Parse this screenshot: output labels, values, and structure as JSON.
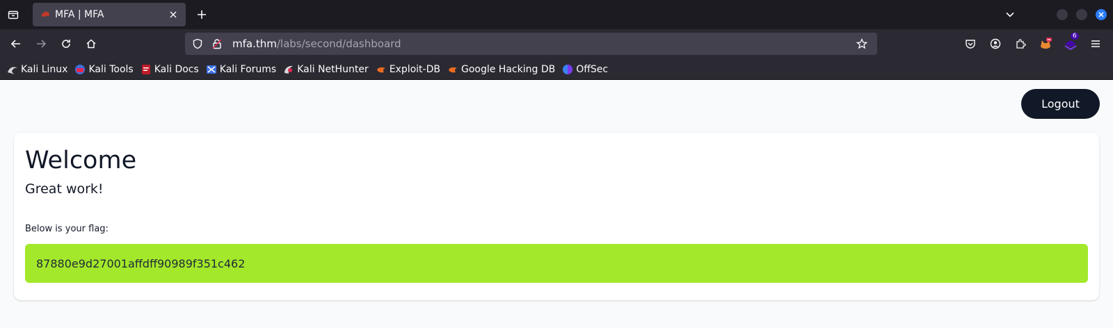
{
  "browser": {
    "tab": {
      "title": "MFA | MFA",
      "favicon": "thm-icon"
    },
    "url": {
      "host": "mfa.thm",
      "path": "/labs/second/dashboard"
    },
    "extension_badge": "6",
    "accent_color": "#2b7cff"
  },
  "bookmarks": [
    {
      "label": "Kali Linux",
      "icon": "kali-dragon-icon"
    },
    {
      "label": "Kali Tools",
      "icon": "kali-tools-icon"
    },
    {
      "label": "Kali Docs",
      "icon": "kali-docs-icon"
    },
    {
      "label": "Kali Forums",
      "icon": "kali-forums-icon"
    },
    {
      "label": "Kali NetHunter",
      "icon": "nethunter-icon"
    },
    {
      "label": "Exploit-DB",
      "icon": "exploit-db-icon"
    },
    {
      "label": "Google Hacking DB",
      "icon": "ghdb-icon"
    },
    {
      "label": "OffSec",
      "icon": "offsec-icon"
    }
  ],
  "page": {
    "logout_label": "Logout",
    "welcome": "Welcome",
    "subtitle": "Great work!",
    "flag_label": "Below is your flag:",
    "flag_value": "87880e9d27001affdff90989f351c462",
    "flag_color": "#a3e82a"
  }
}
